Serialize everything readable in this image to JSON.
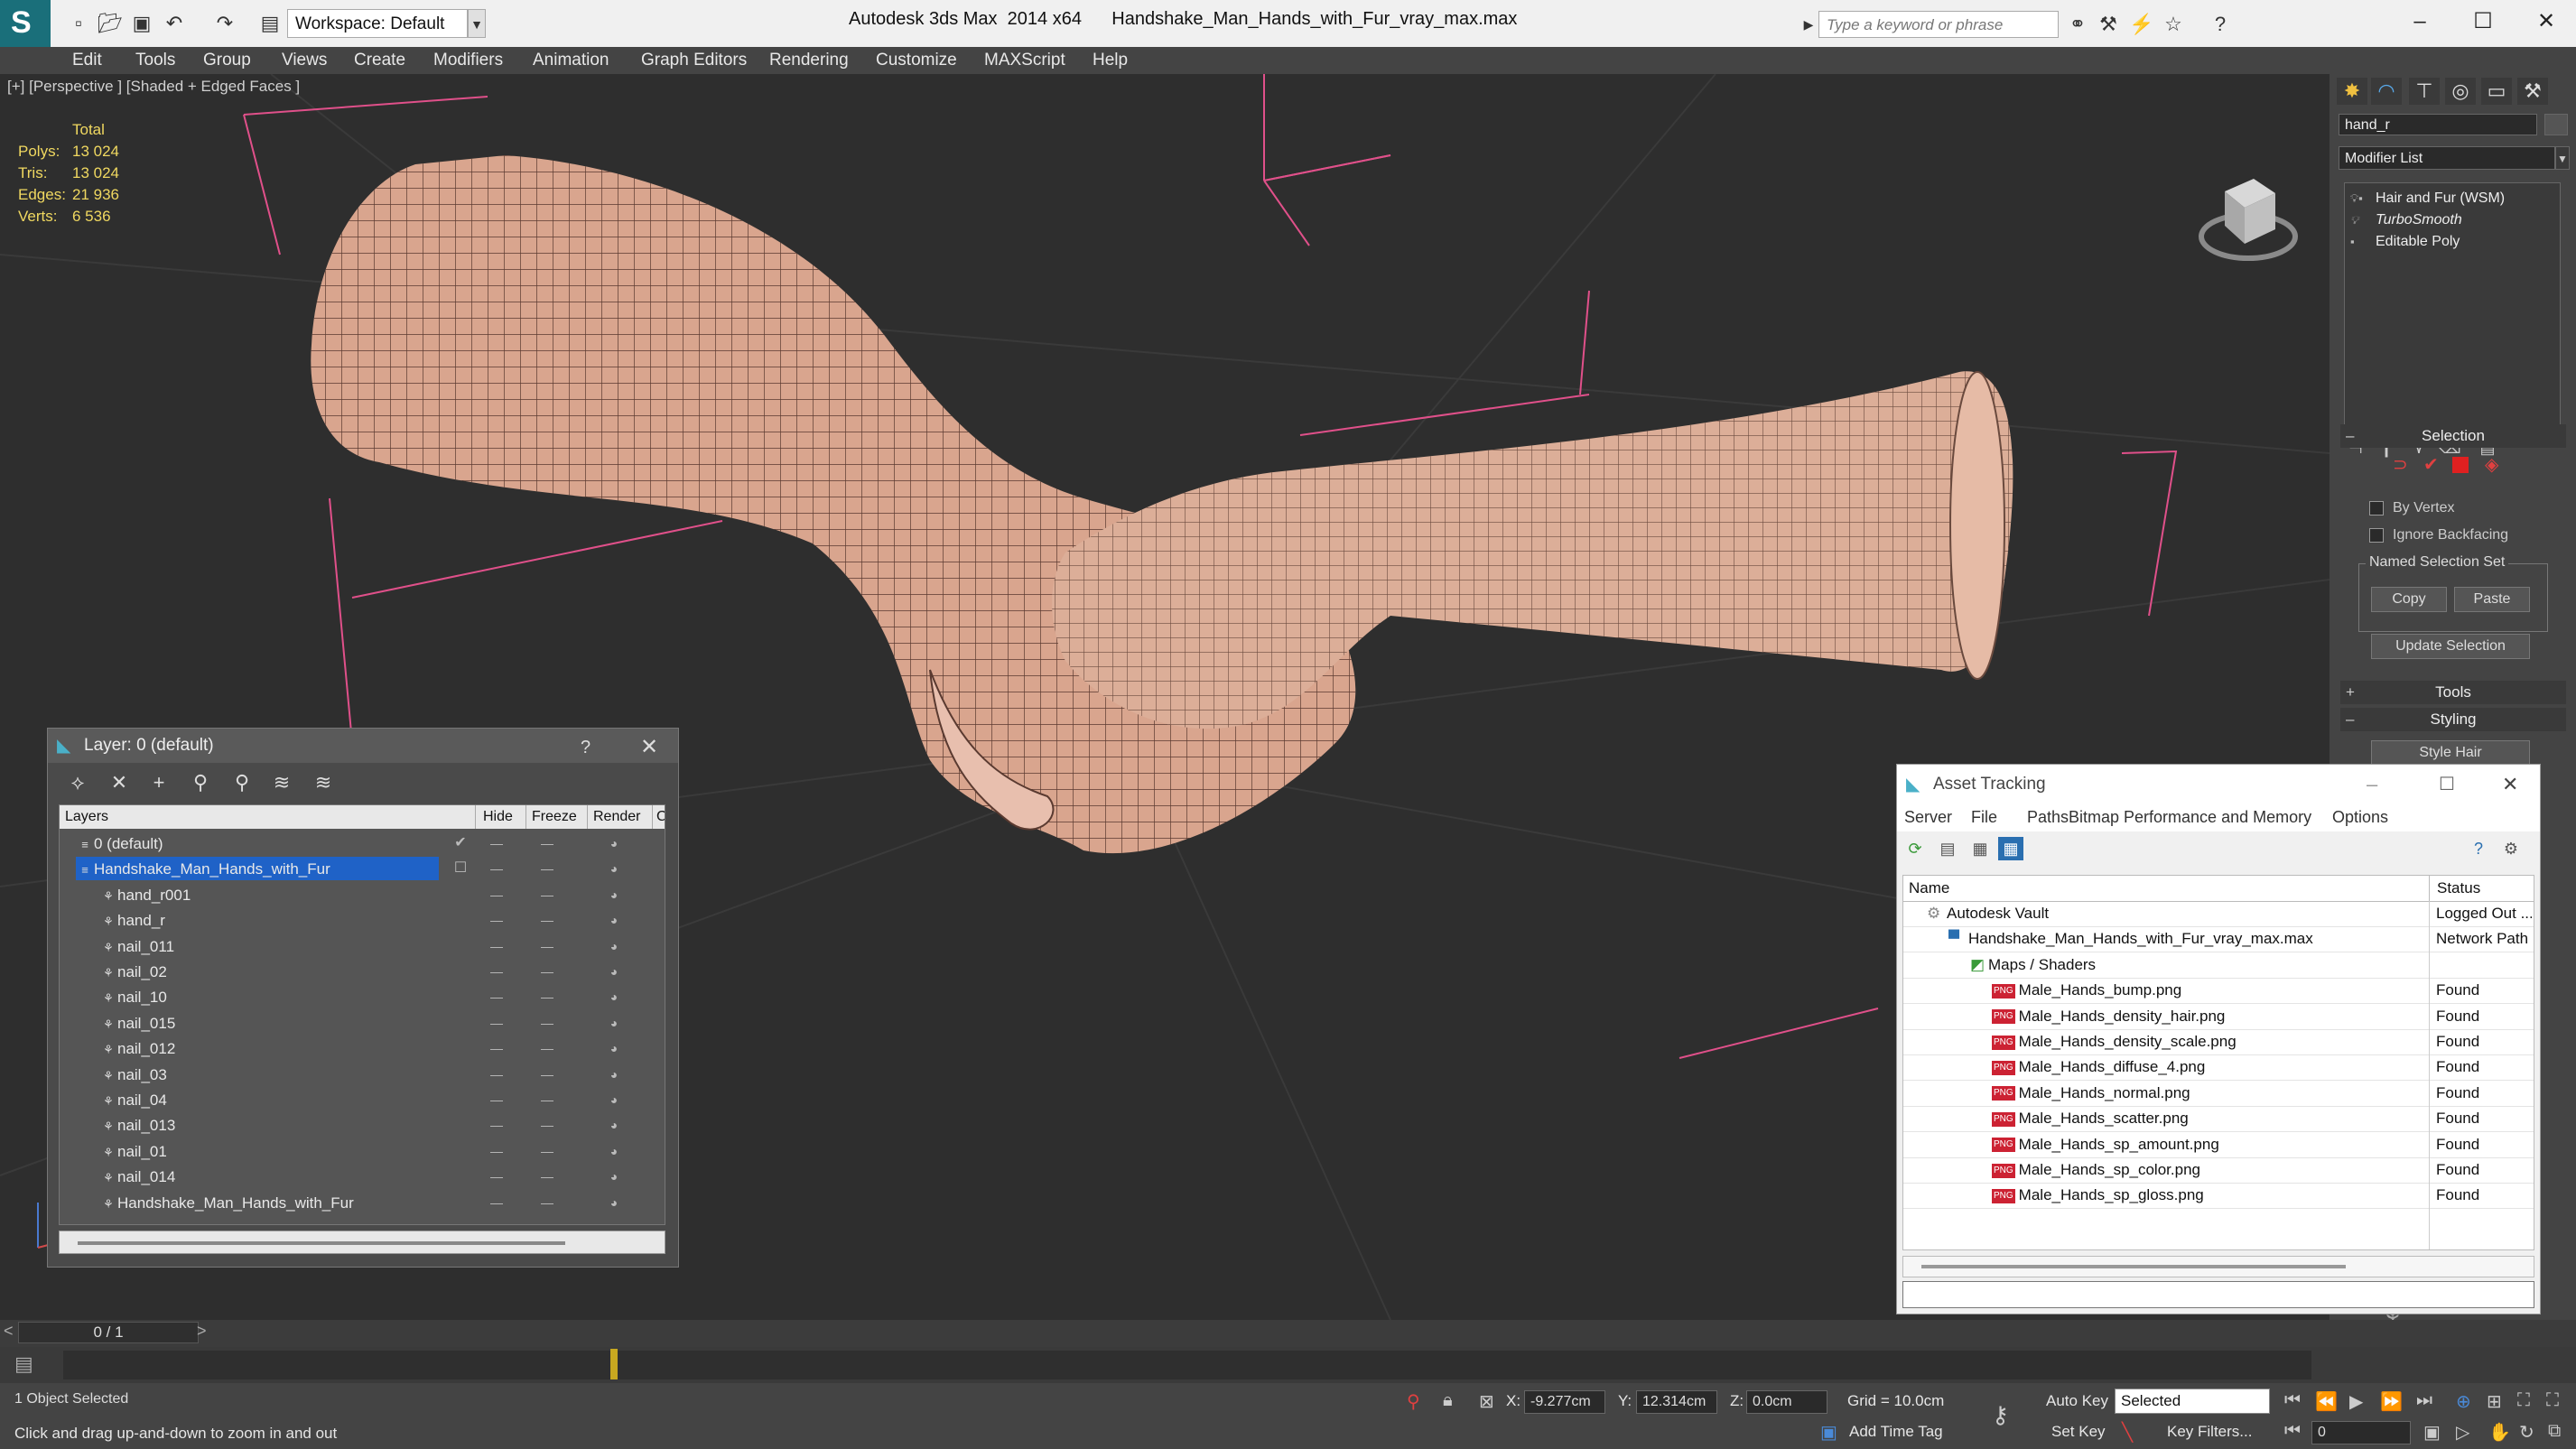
{
  "titlebar": {
    "workspace": "Workspace: Default",
    "app": "Autodesk 3ds Max  2014 x64",
    "file": "Handshake_Man_Hands_with_Fur_vray_max.max",
    "search_placeholder": "Type a keyword or phrase"
  },
  "menu": [
    "Edit",
    "Tools",
    "Group",
    "Views",
    "Create",
    "Modifiers",
    "Animation",
    "Graph Editors",
    "Rendering",
    "Customize",
    "MAXScript",
    "Help"
  ],
  "viewport": {
    "label": "[+] [Perspective ] [Shaded + Edged Faces ]",
    "stats": {
      "total_label": "Total",
      "polys_label": "Polys:",
      "polys": "13 024",
      "tris_label": "Tris:",
      "tris": "13 024",
      "edges_label": "Edges:",
      "edges": "21 936",
      "verts_label": "Verts:",
      "verts": "6 536"
    }
  },
  "command_panel": {
    "object_name": "hand_r",
    "modifier_list": "Modifier List",
    "stack": [
      "Hair and Fur (WSM)",
      "TurboSmooth",
      "Editable Poly"
    ],
    "selection_rollout": "Selection",
    "by_vertex": "By Vertex",
    "ignore_backfacing": "Ignore Backfacing",
    "named_selection_set": "Named Selection Set",
    "copy": "Copy",
    "paste": "Paste",
    "update_selection": "Update Selection",
    "tools_rollout": "Tools",
    "styling_rollout": "Styling",
    "style_hair": "Style Hair"
  },
  "layer_dialog": {
    "title": "Layer: 0 (default)",
    "help": "?",
    "columns": {
      "layers": "Layers",
      "hide": "Hide",
      "freeze": "Freeze",
      "render": "Render",
      "extra": "C"
    },
    "rows": [
      {
        "name": "0 (default)",
        "level": 0,
        "type": "layer",
        "selected": false,
        "current": true
      },
      {
        "name": "Handshake_Man_Hands_with_Fur",
        "level": 0,
        "type": "layer",
        "selected": true,
        "current": false
      },
      {
        "name": "hand_r001",
        "level": 1,
        "type": "object"
      },
      {
        "name": "hand_r",
        "level": 1,
        "type": "object"
      },
      {
        "name": "nail_011",
        "level": 1,
        "type": "object"
      },
      {
        "name": "nail_02",
        "level": 1,
        "type": "object"
      },
      {
        "name": "nail_10",
        "level": 1,
        "type": "object"
      },
      {
        "name": "nail_015",
        "level": 1,
        "type": "object"
      },
      {
        "name": "nail_012",
        "level": 1,
        "type": "object"
      },
      {
        "name": "nail_03",
        "level": 1,
        "type": "object"
      },
      {
        "name": "nail_04",
        "level": 1,
        "type": "object"
      },
      {
        "name": "nail_013",
        "level": 1,
        "type": "object"
      },
      {
        "name": "nail_01",
        "level": 1,
        "type": "object"
      },
      {
        "name": "nail_014",
        "level": 1,
        "type": "object"
      },
      {
        "name": "Handshake_Man_Hands_with_Fur",
        "level": 1,
        "type": "object"
      }
    ]
  },
  "asset_dialog": {
    "title": "Asset Tracking",
    "menu": [
      "Server",
      "File",
      "Paths",
      "Bitmap Performance and Memory",
      "Options"
    ],
    "columns": {
      "name": "Name",
      "status": "Status"
    },
    "rows": [
      {
        "name": "Autodesk Vault",
        "status": "Logged Out ...",
        "level": 0,
        "icon": "vault"
      },
      {
        "name": "Handshake_Man_Hands_with_Fur_vray_max.max",
        "status": "Network Path",
        "level": 1,
        "icon": "max"
      },
      {
        "name": "Maps / Shaders",
        "status": "",
        "level": 2,
        "icon": "maps"
      },
      {
        "name": "Male_Hands_bump.png",
        "status": "Found",
        "level": 3,
        "icon": "png"
      },
      {
        "name": "Male_Hands_density_hair.png",
        "status": "Found",
        "level": 3,
        "icon": "png"
      },
      {
        "name": "Male_Hands_density_scale.png",
        "status": "Found",
        "level": 3,
        "icon": "png"
      },
      {
        "name": "Male_Hands_diffuse_4.png",
        "status": "Found",
        "level": 3,
        "icon": "png"
      },
      {
        "name": "Male_Hands_normal.png",
        "status": "Found",
        "level": 3,
        "icon": "png"
      },
      {
        "name": "Male_Hands_scatter.png",
        "status": "Found",
        "level": 3,
        "icon": "png"
      },
      {
        "name": "Male_Hands_sp_amount.png",
        "status": "Found",
        "level": 3,
        "icon": "png"
      },
      {
        "name": "Male_Hands_sp_color.png",
        "status": "Found",
        "level": 3,
        "icon": "png"
      },
      {
        "name": "Male_Hands_sp_gloss.png",
        "status": "Found",
        "level": 3,
        "icon": "png"
      }
    ]
  },
  "timeline": {
    "frame": "0 / 1",
    "prev": "<",
    "next": ">"
  },
  "status": {
    "selection": "1 Object Selected",
    "prompt": "Click and drag up-and-down to zoom in and out",
    "x_label": "X:",
    "x": "-9.277cm",
    "y_label": "Y:",
    "y": "12.314cm",
    "z_label": "Z:",
    "z": "0.0cm",
    "grid": "Grid = 10.0cm",
    "add_time_tag": "Add Time Tag",
    "auto_key": "Auto Key",
    "set_key": "Set Key",
    "selected": "Selected",
    "key_filters": "Key Filters...",
    "frame_field": "0"
  },
  "colors": {
    "selection_blue": "#1f62c7",
    "mesh_skin": "#d9a58e",
    "grid_pink": "#e0508a",
    "stats_yellow": "#f0d860"
  }
}
